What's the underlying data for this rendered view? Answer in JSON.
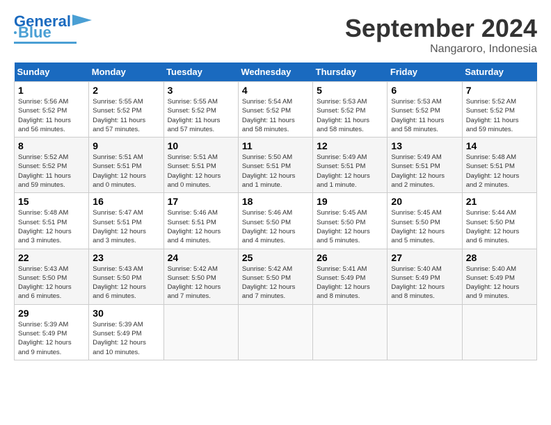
{
  "header": {
    "logo_line1": "General",
    "logo_line2": "Blue",
    "month": "September 2024",
    "location": "Nangaroro, Indonesia"
  },
  "weekdays": [
    "Sunday",
    "Monday",
    "Tuesday",
    "Wednesday",
    "Thursday",
    "Friday",
    "Saturday"
  ],
  "weeks": [
    [
      {
        "day": "1",
        "info": "Sunrise: 5:56 AM\nSunset: 5:52 PM\nDaylight: 11 hours\nand 56 minutes."
      },
      {
        "day": "2",
        "info": "Sunrise: 5:55 AM\nSunset: 5:52 PM\nDaylight: 11 hours\nand 57 minutes."
      },
      {
        "day": "3",
        "info": "Sunrise: 5:55 AM\nSunset: 5:52 PM\nDaylight: 11 hours\nand 57 minutes."
      },
      {
        "day": "4",
        "info": "Sunrise: 5:54 AM\nSunset: 5:52 PM\nDaylight: 11 hours\nand 58 minutes."
      },
      {
        "day": "5",
        "info": "Sunrise: 5:53 AM\nSunset: 5:52 PM\nDaylight: 11 hours\nand 58 minutes."
      },
      {
        "day": "6",
        "info": "Sunrise: 5:53 AM\nSunset: 5:52 PM\nDaylight: 11 hours\nand 58 minutes."
      },
      {
        "day": "7",
        "info": "Sunrise: 5:52 AM\nSunset: 5:52 PM\nDaylight: 11 hours\nand 59 minutes."
      }
    ],
    [
      {
        "day": "8",
        "info": "Sunrise: 5:52 AM\nSunset: 5:52 PM\nDaylight: 11 hours\nand 59 minutes."
      },
      {
        "day": "9",
        "info": "Sunrise: 5:51 AM\nSunset: 5:51 PM\nDaylight: 12 hours\nand 0 minutes."
      },
      {
        "day": "10",
        "info": "Sunrise: 5:51 AM\nSunset: 5:51 PM\nDaylight: 12 hours\nand 0 minutes."
      },
      {
        "day": "11",
        "info": "Sunrise: 5:50 AM\nSunset: 5:51 PM\nDaylight: 12 hours\nand 1 minute."
      },
      {
        "day": "12",
        "info": "Sunrise: 5:49 AM\nSunset: 5:51 PM\nDaylight: 12 hours\nand 1 minute."
      },
      {
        "day": "13",
        "info": "Sunrise: 5:49 AM\nSunset: 5:51 PM\nDaylight: 12 hours\nand 2 minutes."
      },
      {
        "day": "14",
        "info": "Sunrise: 5:48 AM\nSunset: 5:51 PM\nDaylight: 12 hours\nand 2 minutes."
      }
    ],
    [
      {
        "day": "15",
        "info": "Sunrise: 5:48 AM\nSunset: 5:51 PM\nDaylight: 12 hours\nand 3 minutes."
      },
      {
        "day": "16",
        "info": "Sunrise: 5:47 AM\nSunset: 5:51 PM\nDaylight: 12 hours\nand 3 minutes."
      },
      {
        "day": "17",
        "info": "Sunrise: 5:46 AM\nSunset: 5:51 PM\nDaylight: 12 hours\nand 4 minutes."
      },
      {
        "day": "18",
        "info": "Sunrise: 5:46 AM\nSunset: 5:50 PM\nDaylight: 12 hours\nand 4 minutes."
      },
      {
        "day": "19",
        "info": "Sunrise: 5:45 AM\nSunset: 5:50 PM\nDaylight: 12 hours\nand 5 minutes."
      },
      {
        "day": "20",
        "info": "Sunrise: 5:45 AM\nSunset: 5:50 PM\nDaylight: 12 hours\nand 5 minutes."
      },
      {
        "day": "21",
        "info": "Sunrise: 5:44 AM\nSunset: 5:50 PM\nDaylight: 12 hours\nand 6 minutes."
      }
    ],
    [
      {
        "day": "22",
        "info": "Sunrise: 5:43 AM\nSunset: 5:50 PM\nDaylight: 12 hours\nand 6 minutes."
      },
      {
        "day": "23",
        "info": "Sunrise: 5:43 AM\nSunset: 5:50 PM\nDaylight: 12 hours\nand 6 minutes."
      },
      {
        "day": "24",
        "info": "Sunrise: 5:42 AM\nSunset: 5:50 PM\nDaylight: 12 hours\nand 7 minutes."
      },
      {
        "day": "25",
        "info": "Sunrise: 5:42 AM\nSunset: 5:50 PM\nDaylight: 12 hours\nand 7 minutes."
      },
      {
        "day": "26",
        "info": "Sunrise: 5:41 AM\nSunset: 5:49 PM\nDaylight: 12 hours\nand 8 minutes."
      },
      {
        "day": "27",
        "info": "Sunrise: 5:40 AM\nSunset: 5:49 PM\nDaylight: 12 hours\nand 8 minutes."
      },
      {
        "day": "28",
        "info": "Sunrise: 5:40 AM\nSunset: 5:49 PM\nDaylight: 12 hours\nand 9 minutes."
      }
    ],
    [
      {
        "day": "29",
        "info": "Sunrise: 5:39 AM\nSunset: 5:49 PM\nDaylight: 12 hours\nand 9 minutes."
      },
      {
        "day": "30",
        "info": "Sunrise: 5:39 AM\nSunset: 5:49 PM\nDaylight: 12 hours\nand 10 minutes."
      },
      {
        "day": "",
        "info": ""
      },
      {
        "day": "",
        "info": ""
      },
      {
        "day": "",
        "info": ""
      },
      {
        "day": "",
        "info": ""
      },
      {
        "day": "",
        "info": ""
      }
    ]
  ]
}
